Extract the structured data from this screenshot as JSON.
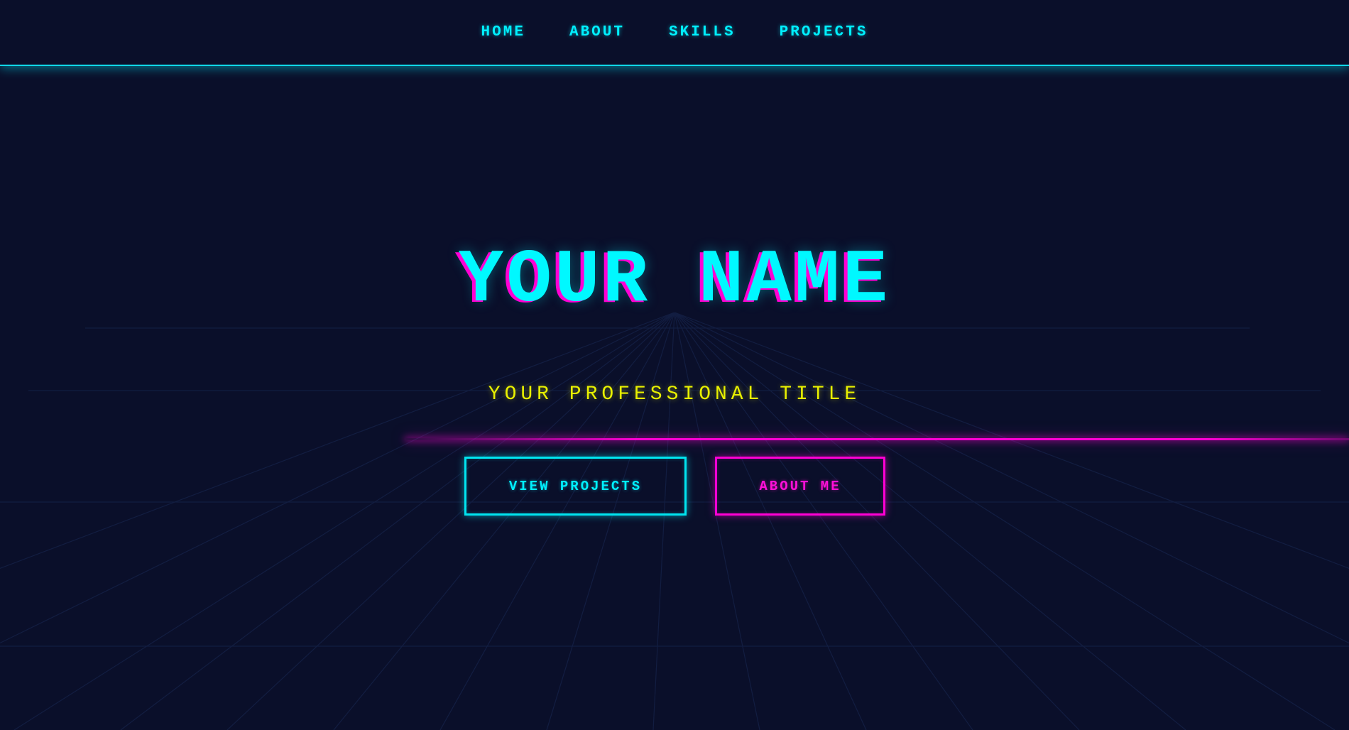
{
  "nav": {
    "items": [
      {
        "label": "HOME"
      },
      {
        "label": "ABOUT"
      },
      {
        "label": "SKILLS"
      },
      {
        "label": "PROJECTS"
      }
    ]
  },
  "hero": {
    "title": "YOUR NAME",
    "subtitle": "YOUR PROFESSIONAL TITLE",
    "primary_button": "VIEW PROJECTS",
    "secondary_button": "ABOUT ME"
  },
  "colors": {
    "background": "#0a0f2a",
    "cyan": "#00f0ff",
    "magenta": "#ff00d4",
    "yellow": "#e8f000"
  }
}
